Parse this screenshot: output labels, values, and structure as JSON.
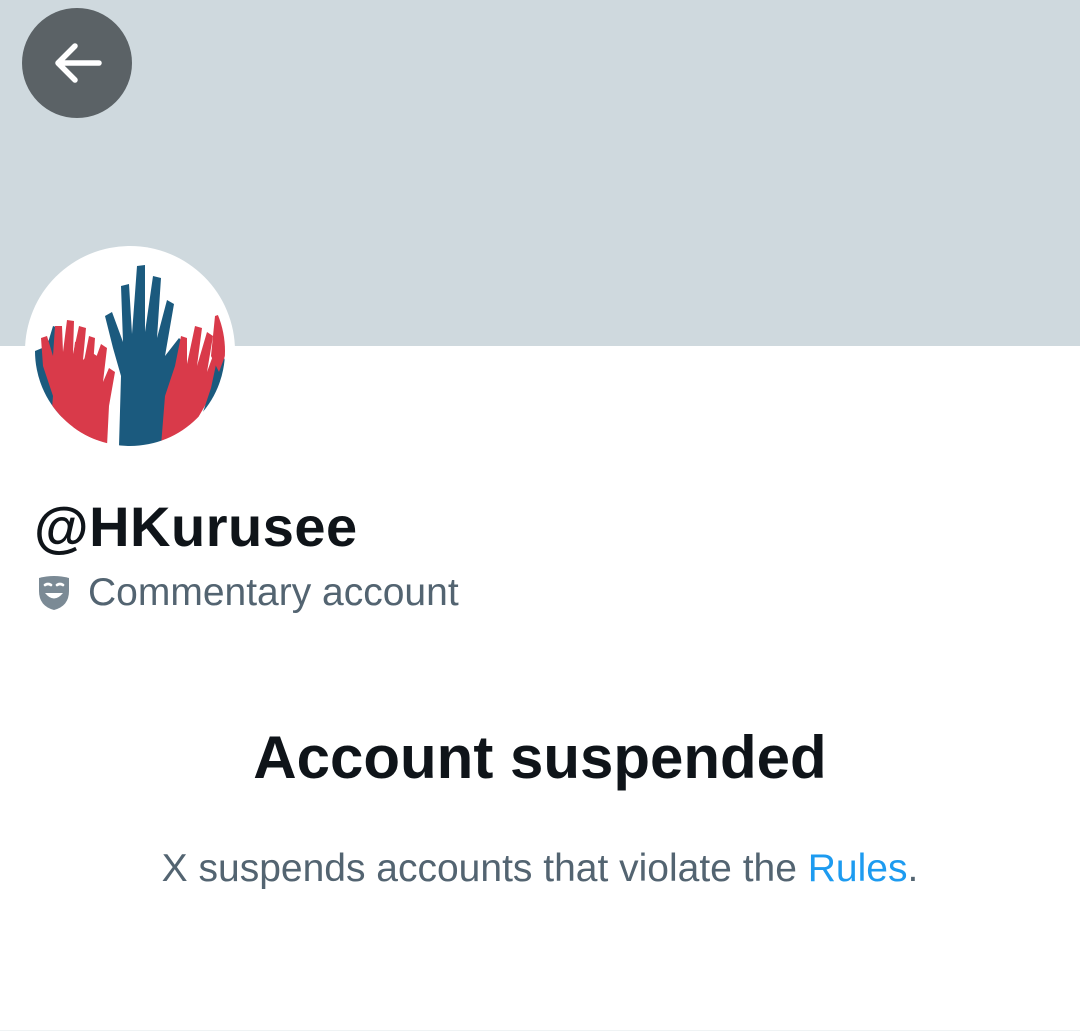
{
  "profile": {
    "handle": "@HKurusee",
    "label": "Commentary account",
    "label_icon": "theater-mask-icon",
    "avatar_icon": "raised-hands-icon"
  },
  "navigation": {
    "back_icon": "arrow-left-icon"
  },
  "suspension": {
    "title": "Account suspended",
    "description_prefix": "X suspends accounts that violate the ",
    "rules_link": "Rules",
    "description_suffix": "."
  },
  "colors": {
    "banner": "#cfd9de",
    "back_button": "#5b6266",
    "primary_text": "#0f1419",
    "secondary_text": "#536471",
    "link": "#1d9bf0",
    "avatar_red": "#d93a4a",
    "avatar_blue": "#1b5a7e"
  }
}
